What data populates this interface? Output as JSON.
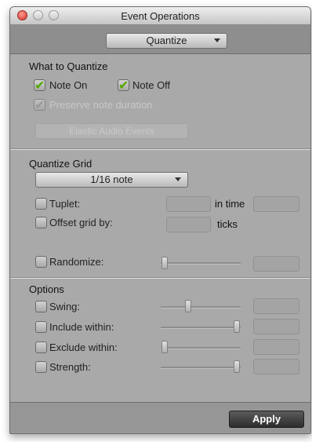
{
  "window": {
    "title": "Event Operations"
  },
  "operation": {
    "selected": "Quantize"
  },
  "what_to_quantize": {
    "title": "What to Quantize",
    "note_on": {
      "label": "Note On",
      "checked": true
    },
    "note_off": {
      "label": "Note Off",
      "checked": true
    },
    "preserve": {
      "label": "Preserve note duration",
      "checked": true,
      "enabled": false
    },
    "elastic_button": {
      "label": "Elastic Audio Events",
      "enabled": false
    }
  },
  "quantize_grid": {
    "title": "Quantize Grid",
    "grid_value": "1/16 note",
    "tuplet": {
      "label": "Tuplet:",
      "in_time_label": "in time"
    },
    "offset": {
      "label": "Offset grid by:",
      "unit": "ticks"
    },
    "randomize": {
      "label": "Randomize:"
    }
  },
  "options": {
    "title": "Options",
    "swing": {
      "label": "Swing:"
    },
    "include": {
      "label": "Include within:"
    },
    "exclude": {
      "label": "Exclude within:"
    },
    "strength": {
      "label": "Strength:"
    }
  },
  "footer": {
    "apply_label": "Apply"
  }
}
